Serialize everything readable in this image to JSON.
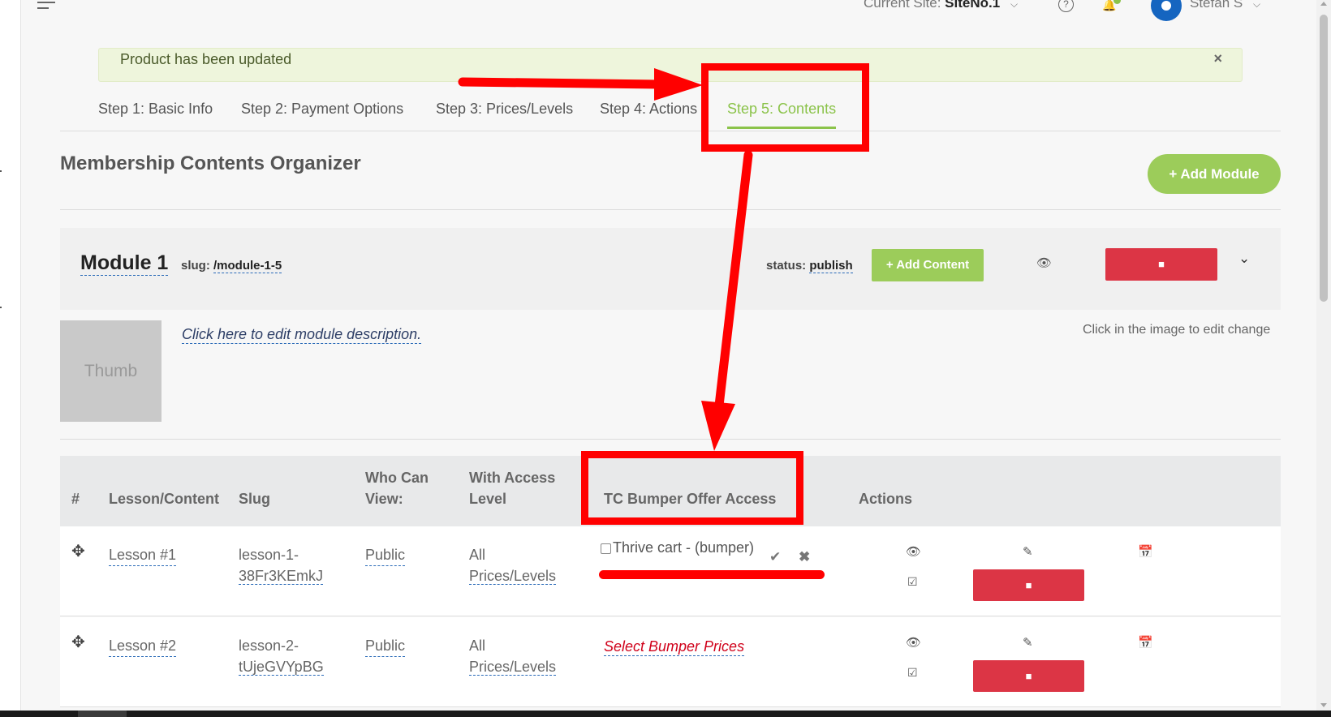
{
  "topbar": {
    "site_label": "Current Site:",
    "site_name": "SiteNo.1",
    "user_name": "Stefan S"
  },
  "alert": {
    "message": "Product has been updated",
    "close": "×"
  },
  "tabs": [
    {
      "label": "Step 1: Basic Info"
    },
    {
      "label": "Step 2: Payment Options"
    },
    {
      "label": "Step 3: Prices/Levels"
    },
    {
      "label": "Step 4: Actions"
    },
    {
      "label": "Step 5: Contents",
      "active": true
    }
  ],
  "page": {
    "title": "Membership Contents Organizer",
    "add_module": "Add Module"
  },
  "module": {
    "name": "Module 1",
    "slug_label": "slug:",
    "slug_value": "/module-1-5",
    "status_label": "status:",
    "status_value": "publish",
    "add_content": "Add Content",
    "thumb_label": "Thumb",
    "description": "Click here to edit module description.",
    "image_hint": "Click in the image to edit change"
  },
  "table": {
    "headers": {
      "num": "#",
      "lesson": "Lesson/Content",
      "slug": "Slug",
      "who_line1": "Who Can",
      "who_line2": "View:",
      "access_line1": "With Access",
      "access_line2": "Level",
      "bumper": "TC Bumper Offer Access",
      "actions": "Actions"
    },
    "rows": [
      {
        "lesson": "Lesson #1",
        "slug_line1": "lesson-1-",
        "slug_line2": "38Fr3KEmkJ",
        "who": "Public",
        "access_line1": "All",
        "access_line2": "Prices/Levels",
        "bumper_checkbox_label": "Thrive cart - (bumper)"
      },
      {
        "lesson": "Lesson #2",
        "slug_line1": "lesson-2-",
        "slug_line2": "tUjeGVYpBG",
        "who": "Public",
        "access_line1": "All",
        "access_line2": "Prices/Levels",
        "bumper_link": "Select Bumper Prices"
      }
    ]
  },
  "colors": {
    "accent_green": "#8bc34a",
    "button_green": "#9ccc5a",
    "danger_red": "#dc3545",
    "annotation_red": "#ff0000"
  },
  "icons": [
    "hamburger-icon",
    "chevron-down-icon",
    "help-icon",
    "bell-icon",
    "avatar-icon",
    "close-icon",
    "plus-icon",
    "eye-icon",
    "trash-icon",
    "move-icon",
    "check-icon",
    "times-icon",
    "pencil-icon",
    "checkbox-icon",
    "calendar-icon"
  ]
}
